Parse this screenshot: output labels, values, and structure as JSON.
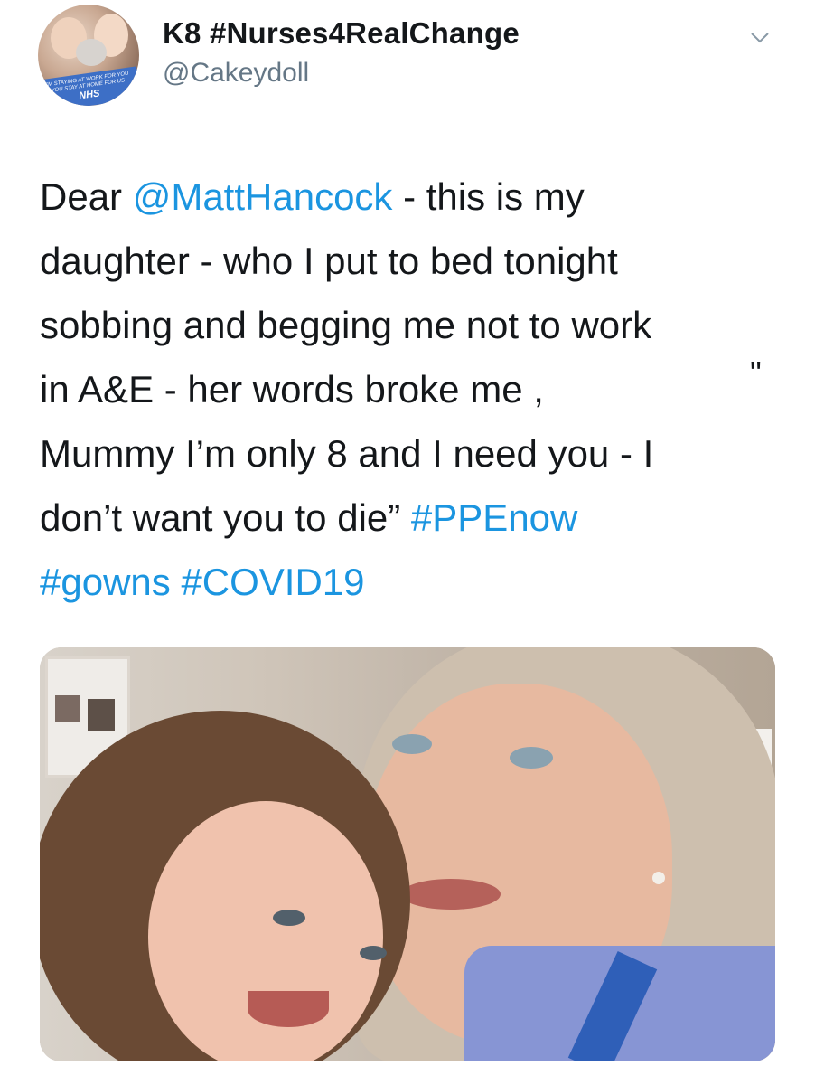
{
  "author": {
    "display_name": "K8 #Nurses4RealChange",
    "handle": "@Cakeydoll",
    "avatar_banner_text": "I'M STAYING AT WORK FOR YOU\nYOU STAY AT HOME FOR US",
    "avatar_banner_logo": "NHS"
  },
  "menu": {
    "icon": "chevron-down-icon"
  },
  "tweet": {
    "lines": [
      [
        {
          "text": "Dear ",
          "type": "text"
        },
        {
          "text": "@MattHancock",
          "type": "mention"
        },
        {
          "text": " - this is my",
          "type": "text"
        }
      ],
      [
        {
          "text": "daughter - who I put to bed tonight",
          "type": "text"
        }
      ],
      [
        {
          "text": "sobbing and begging me not to work",
          "type": "text"
        }
      ],
      [
        {
          "text": "in A&E - her words broke me ,",
          "type": "text"
        }
      ],
      [
        {
          "text": "Mummy I’m only 8 and I need you - I",
          "type": "text"
        }
      ],
      [
        {
          "text": "don’t want you to die” ",
          "type": "text"
        },
        {
          "text": "#PPEnow",
          "type": "hashtag"
        }
      ],
      [
        {
          "text": "#gowns",
          "type": "hashtag"
        },
        {
          "text": " ",
          "type": "text"
        },
        {
          "text": "#COVID19",
          "type": "hashtag"
        }
      ]
    ],
    "stray_quote": "\""
  },
  "colors": {
    "link": "#1b95e0",
    "text": "#14171a",
    "secondary": "#657786"
  }
}
